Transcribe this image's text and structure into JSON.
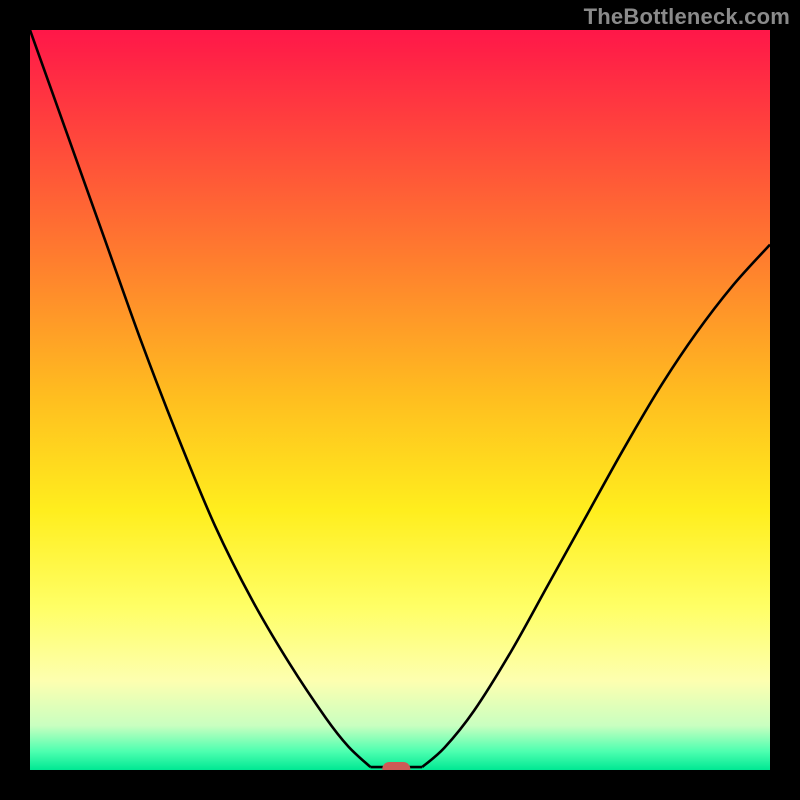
{
  "attribution": "TheBottleneck.com",
  "chart_data": {
    "type": "line",
    "title": "",
    "xlabel": "",
    "ylabel": "",
    "xlim": [
      0,
      1
    ],
    "ylim": [
      0,
      100
    ],
    "gradient_stops": [
      {
        "offset": 0.0,
        "color": "#ff1749"
      },
      {
        "offset": 0.12,
        "color": "#ff3e3e"
      },
      {
        "offset": 0.3,
        "color": "#ff7a2f"
      },
      {
        "offset": 0.5,
        "color": "#ffbf1f"
      },
      {
        "offset": 0.65,
        "color": "#ffee1e"
      },
      {
        "offset": 0.78,
        "color": "#ffff66"
      },
      {
        "offset": 0.88,
        "color": "#fdffb0"
      },
      {
        "offset": 0.94,
        "color": "#c9ffc0"
      },
      {
        "offset": 0.975,
        "color": "#4dffb0"
      },
      {
        "offset": 1.0,
        "color": "#00e893"
      }
    ],
    "series": [
      {
        "name": "left-curve",
        "x": [
          0.0,
          0.05,
          0.1,
          0.15,
          0.2,
          0.25,
          0.3,
          0.35,
          0.4,
          0.43,
          0.46
        ],
        "values": [
          100.0,
          86.0,
          72.0,
          58.0,
          45.0,
          33.0,
          23.0,
          14.5,
          7.0,
          3.2,
          0.4
        ]
      },
      {
        "name": "right-curve",
        "x": [
          0.53,
          0.56,
          0.6,
          0.65,
          0.7,
          0.75,
          0.8,
          0.85,
          0.9,
          0.95,
          1.0
        ],
        "values": [
          0.4,
          3.0,
          8.0,
          16.0,
          25.0,
          34.0,
          43.0,
          51.5,
          59.0,
          65.5,
          71.0
        ]
      }
    ],
    "minimum_marker": {
      "center_x": 0.495,
      "center_y": 0.0,
      "color": "#cd5b56",
      "label": "bottleneck-minimum"
    },
    "flat_segment": {
      "x_start": 0.46,
      "x_end": 0.53,
      "y": 0.4
    }
  }
}
